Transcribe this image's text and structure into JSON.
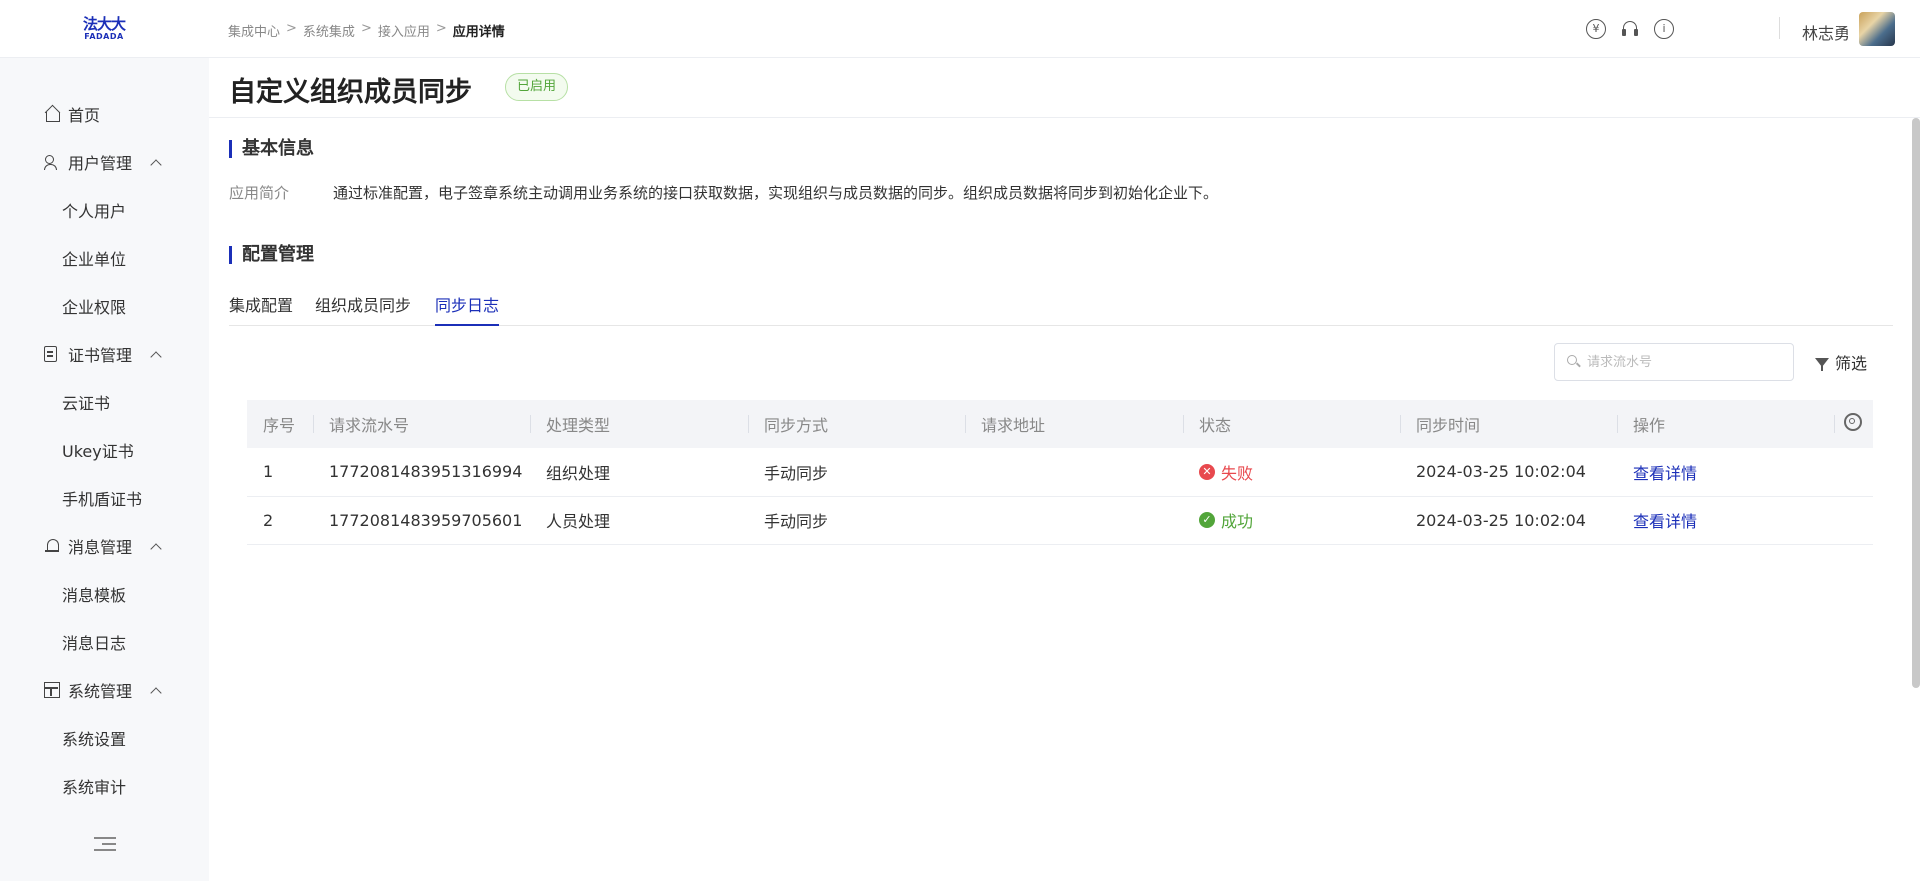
{
  "logo": {
    "cn": "法大大",
    "en": "FADADA"
  },
  "breadcrumb": [
    "集成中心",
    "系统集成",
    "接入应用",
    "应用详情"
  ],
  "header": {
    "username": "林志勇",
    "icons": [
      "yuan-icon",
      "headset-icon",
      "info-icon"
    ]
  },
  "sidebar": {
    "items": [
      {
        "label": "首页",
        "type": "top",
        "icon": "home-icon"
      },
      {
        "label": "用户管理",
        "type": "group",
        "icon": "users-icon"
      },
      {
        "label": "个人用户",
        "type": "sub"
      },
      {
        "label": "企业单位",
        "type": "sub"
      },
      {
        "label": "企业权限",
        "type": "sub"
      },
      {
        "label": "证书管理",
        "type": "group",
        "icon": "document-icon"
      },
      {
        "label": "云证书",
        "type": "sub"
      },
      {
        "label": "Ukey证书",
        "type": "sub"
      },
      {
        "label": "手机盾证书",
        "type": "sub"
      },
      {
        "label": "消息管理",
        "type": "group",
        "icon": "bell-icon"
      },
      {
        "label": "消息模板",
        "type": "sub"
      },
      {
        "label": "消息日志",
        "type": "sub"
      },
      {
        "label": "系统管理",
        "type": "group",
        "icon": "system-icon"
      },
      {
        "label": "系统设置",
        "type": "sub"
      },
      {
        "label": "系统审计",
        "type": "sub"
      }
    ]
  },
  "page": {
    "title": "自定义组织成员同步",
    "status": "已启用"
  },
  "basic_info": {
    "section_title": "基本信息",
    "intro_label": "应用简介",
    "intro_text": "通过标准配置，电子签章系统主动调用业务系统的接口获取数据，实现组织与成员数据的同步。组织成员数据将同步到初始化企业下。"
  },
  "config": {
    "section_title": "配置管理",
    "tabs": [
      {
        "label": "集成配置",
        "active": false
      },
      {
        "label": "组织成员同步",
        "active": false
      },
      {
        "label": "同步日志",
        "active": true
      }
    ]
  },
  "search": {
    "placeholder": "请求流水号",
    "value": ""
  },
  "filter": {
    "label": "筛选"
  },
  "table": {
    "columns": [
      "序号",
      "请求流水号",
      "处理类型",
      "同步方式",
      "请求地址",
      "状态",
      "同步时间",
      "操作"
    ],
    "rows": [
      {
        "index": "1",
        "serial": "1772081483951316994",
        "type": "组织处理",
        "mode": "手动同步",
        "url": "",
        "status": "失败",
        "status_kind": "fail",
        "time": "2024-03-25 10:02:04",
        "action": "查看详情"
      },
      {
        "index": "2",
        "serial": "1772081483959705601",
        "type": "人员处理",
        "mode": "手动同步",
        "url": "",
        "status": "成功",
        "status_kind": "ok",
        "time": "2024-03-25 10:02:04",
        "action": "查看详情"
      }
    ]
  },
  "colors": {
    "brand": "#1b2fb8",
    "success": "#52a53a",
    "fail": "#e8494e"
  }
}
